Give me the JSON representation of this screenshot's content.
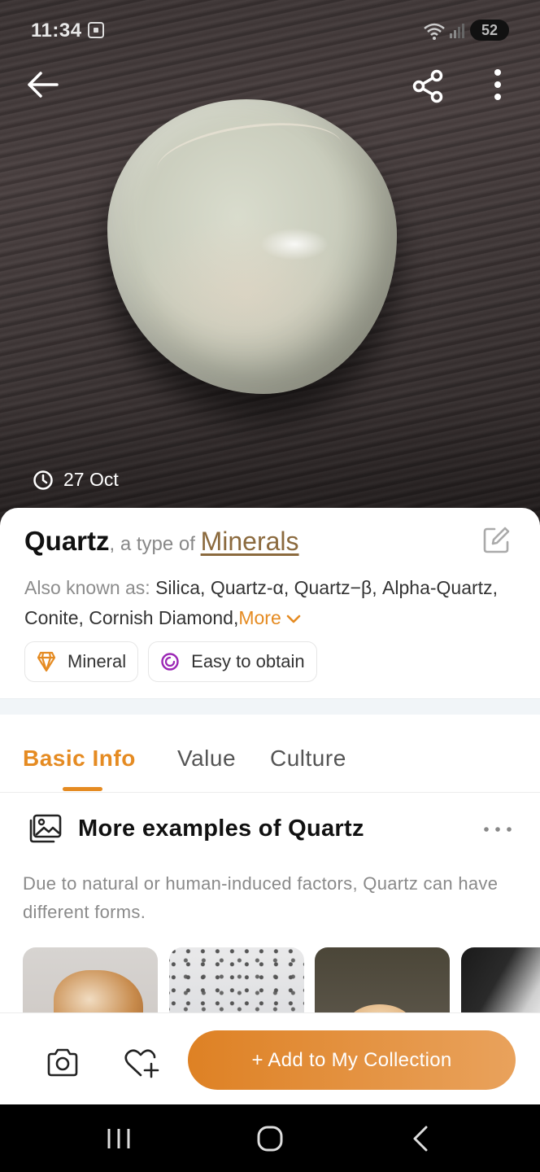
{
  "status_bar": {
    "time": "11:34",
    "battery": "52"
  },
  "hero": {
    "date": "27 Oct"
  },
  "header": {
    "name": "Quartz",
    "type_prefix": ", a type of ",
    "category": "Minerals"
  },
  "aka": {
    "label": "Also known as: ",
    "names": "Silica, Quartz-α, Quartz−β, Alpha-Quartz, Conite, Cornish Diamond,",
    "more": "More"
  },
  "tags": [
    {
      "label": "Mineral",
      "icon": "gem-icon"
    },
    {
      "label": "Easy to obtain",
      "icon": "ring-icon"
    }
  ],
  "tabs": [
    {
      "label": "Basic Info",
      "active": true
    },
    {
      "label": "Value",
      "active": false
    },
    {
      "label": "Culture",
      "active": false
    }
  ],
  "section": {
    "title": "More examples of Quartz",
    "description": "Due to natural or human-induced factors, Quartz can have different forms."
  },
  "action_bar": {
    "add_label": "+ Add to My Collection"
  },
  "colors": {
    "accent": "#e58b22",
    "link": "#8b6a3e"
  }
}
